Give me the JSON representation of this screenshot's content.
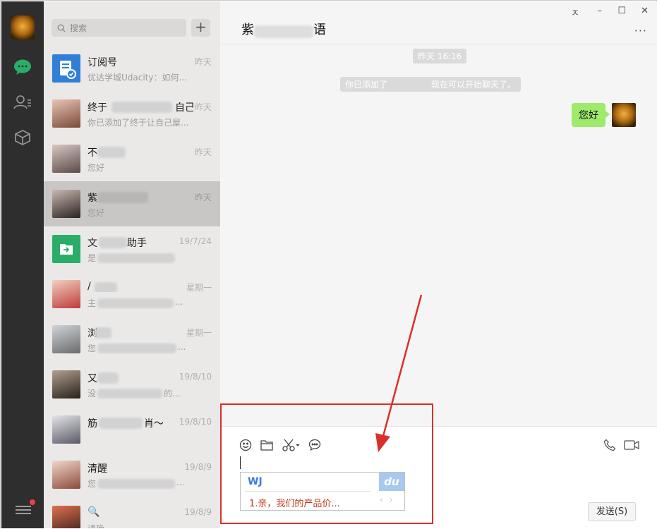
{
  "window": {
    "pin_glyph": "ㅈ",
    "min_glyph": "–",
    "max_glyph": "☐",
    "close_glyph": "✕"
  },
  "sidebar": {
    "search_placeholder": "搜索",
    "add_label": "+",
    "items": [
      {
        "name": "订阅号",
        "preview": "优达学城Udacity：如何...",
        "time": "昨天"
      },
      {
        "name": "终于",
        "name_tail": "自己",
        "preview": "你已添加了终于让自己屋...",
        "time": "昨天"
      },
      {
        "name": "不",
        "preview": "您好",
        "time": "昨天"
      },
      {
        "name": "紫",
        "preview": "您好",
        "time": "昨天",
        "active": true
      },
      {
        "name": "文",
        "name_tail": "助手",
        "preview": "是",
        "time": "19/7/24"
      },
      {
        "name": "/",
        "preview": "主",
        "preview_tail": "...",
        "time": "星期一"
      },
      {
        "name": "浏",
        "preview": "您",
        "preview_tail": "...",
        "time": "星期一"
      },
      {
        "name": "又",
        "preview": "没",
        "preview_tail": "的...",
        "time": "19/8/10"
      },
      {
        "name": "筋",
        "name_tail": "肖～",
        "preview": "",
        "time": "19/8/10"
      },
      {
        "name": "清醒",
        "preview": "您",
        "preview_tail": "...",
        "time": "19/8/9"
      },
      {
        "name": "🔍",
        "preview": "请确",
        "time": "19/8/9"
      }
    ]
  },
  "chat": {
    "title_start": "紫",
    "title_end": "语",
    "more_label": "···",
    "timestamp": "昨天 16:16",
    "system_msg_start": "你已添加了",
    "system_msg_end": "现在可以开始聊天了。",
    "my_message": "您好"
  },
  "composer": {
    "ime_composition": "WJ",
    "ime_logo": "du",
    "ime_candidate": "1.亲，我们的产品价...",
    "ime_nav": "‹›",
    "send_label": "发送(S)"
  },
  "colors": {
    "accent_green": "#2aae67",
    "bubble_green": "#9eea6a",
    "annotation_red": "#d9302a"
  }
}
